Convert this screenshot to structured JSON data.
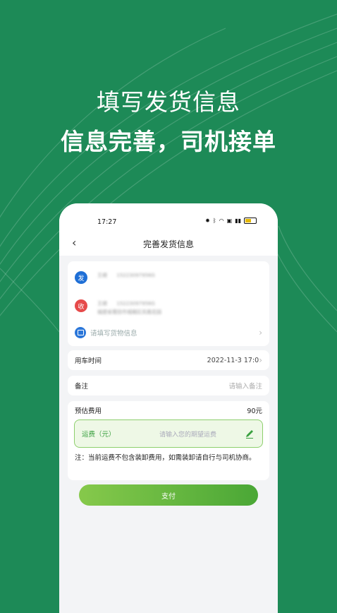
{
  "headline": {
    "line1": "填写发货信息",
    "line2": "信息完善，司机接单"
  },
  "status_bar": {
    "time": "17:27",
    "battery_level": "51"
  },
  "nav": {
    "back_icon": "chevron-left-icon",
    "title": "完善发货信息"
  },
  "address": {
    "sender_badge": "发",
    "sender_name": "王顺",
    "sender_phone": "15223097956G",
    "receiver_badge": "收",
    "receiver_name": "王顺",
    "receiver_phone": "15223097956G",
    "receiver_address": "福建省莆田市城厢区凤凰花园",
    "goods_placeholder": "请填写货物信息"
  },
  "use_time": {
    "label": "用车时间",
    "value": "2022-11-3 17:0"
  },
  "remark": {
    "label": "备注",
    "placeholder": "请输入备注"
  },
  "fee": {
    "label": "预估费用",
    "value": "90元",
    "freight_label": "运费（元）",
    "freight_placeholder": "请输入您的期望运费",
    "note": "注：当前运费不包含装卸费用，如需装卸请自行与司机协商。"
  },
  "pay_button": "支付",
  "colors": {
    "background": "#1d8a57",
    "accent_green": "#4aa736",
    "send_blue": "#1f6fd6",
    "receive_red": "#e64a4a"
  }
}
